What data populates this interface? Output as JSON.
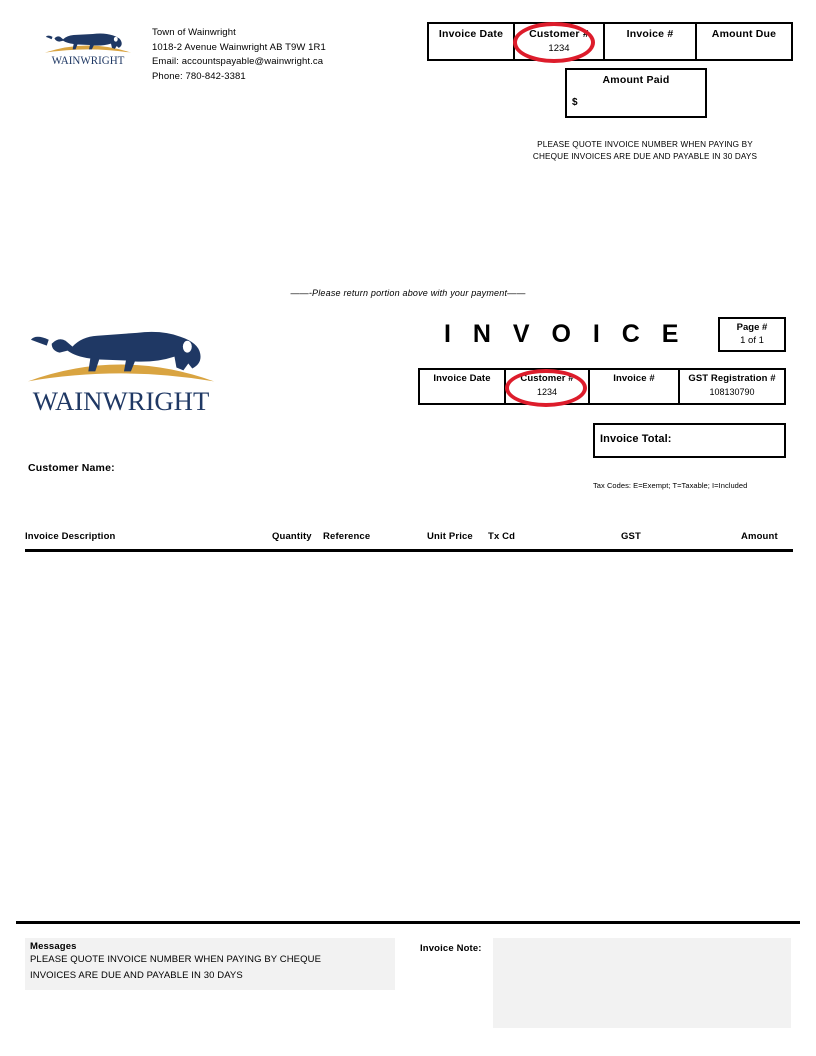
{
  "document": {
    "type": "invoice",
    "title": "I N V O I C E"
  },
  "remittance": {
    "logo_alt": "wainwright-logo",
    "address": {
      "org": "Town of Wainwright",
      "street": "1018-2 Avenue Wainwright AB T9W 1R1",
      "email": "Email: accountspayable@wainwright.ca",
      "phone": "Phone: 780-842-3381"
    },
    "table": {
      "headers": [
        "Invoice Date",
        "Customer #",
        "Invoice #",
        "Amount Due"
      ],
      "values": [
        "",
        "1234",
        "",
        ""
      ]
    },
    "amount_paid": {
      "label": "Amount Paid",
      "currency_symbol": "$",
      "value": ""
    },
    "notice_line1": "PLEASE QUOTE INVOICE NUMBER WHEN PAYING BY",
    "notice_line2": "CHEQUE INVOICES ARE DUE AND PAYABLE IN 30 DAYS"
  },
  "perforation_note": "——-Please return portion above with your payment——",
  "main": {
    "logo_alt": "wainwright-logo",
    "page_box": {
      "label": "Page #",
      "value": "1 of 1"
    },
    "table": {
      "headers": [
        "Invoice Date",
        "Customer #",
        "Invoice #",
        "GST Registration #"
      ],
      "values": [
        "",
        "1234",
        "",
        "108130790"
      ]
    },
    "invoice_total_label": "Invoice Total:",
    "invoice_total_value": "",
    "tax_codes": "Tax Codes:  E=Exempt; T=Taxable; I=Included",
    "customer_name_label": "Customer Name:",
    "customer_name_value": "",
    "columns": [
      "Invoice Description",
      "Quantity",
      "Reference",
      "Unit Price",
      "Tx Cd",
      "GST",
      "Amount"
    ],
    "line_items": []
  },
  "footer": {
    "messages_title": "Messages",
    "messages_line1": "PLEASE QUOTE INVOICE NUMBER WHEN PAYING BY CHEQUE",
    "messages_line2": "INVOICES ARE DUE AND PAYABLE IN 30 DAYS",
    "invoice_note_label": "Invoice Note:",
    "invoice_note_value": ""
  },
  "annotations": {
    "circle_color": "#dd1c2b",
    "circled_field_stub": "Customer #",
    "circled_field_main": "Customer #"
  },
  "colors": {
    "logo_blue": "#1f3864",
    "logo_gold": "#d9a441",
    "panel_gray": "#f2f2f2",
    "annotation_red": "#dd1c2b"
  }
}
